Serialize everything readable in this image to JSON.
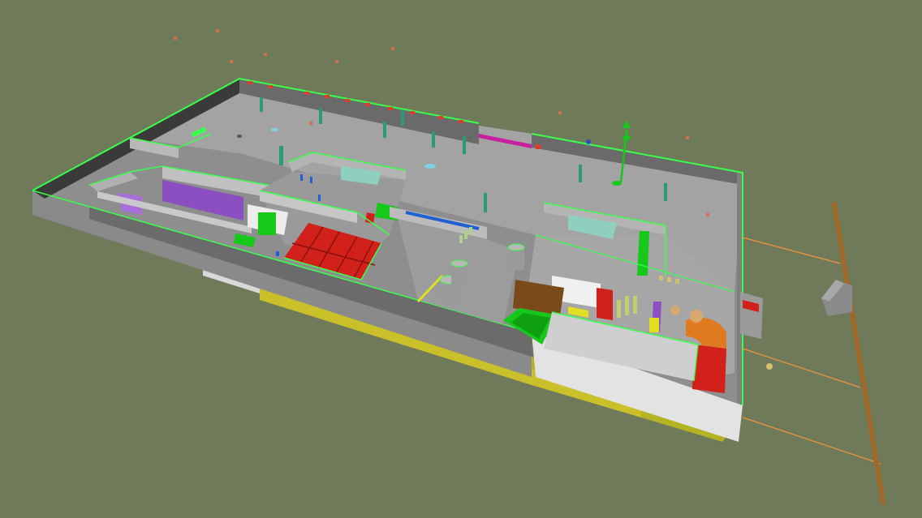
{
  "viewport": {
    "background": "#6f7a5a",
    "content": "3d-bim-building-model"
  },
  "colors": {
    "floor": "#8e8e8e",
    "wall_top": "#bdbdbd",
    "wall_side": "#7a7a7a",
    "edge_highlight": "#39ff4a",
    "foundation_orange": "#c8662a",
    "foundation_yellow": "#b3b323",
    "red_equipment": "#d2201a",
    "green_equipment": "#16c81a",
    "purple_room": "#8c4fc2",
    "magenta_strip": "#c81ea0",
    "blue_pipe": "#2060d0",
    "pole": "#a0692a",
    "cable": "#e09040",
    "column_teal": "#2a9a7a",
    "white_panel": "#e8e8e8",
    "cylinder_grey": "#9a9a9a"
  },
  "icons": {
    "axis_gizmo": "axis-gizmo-icon"
  }
}
